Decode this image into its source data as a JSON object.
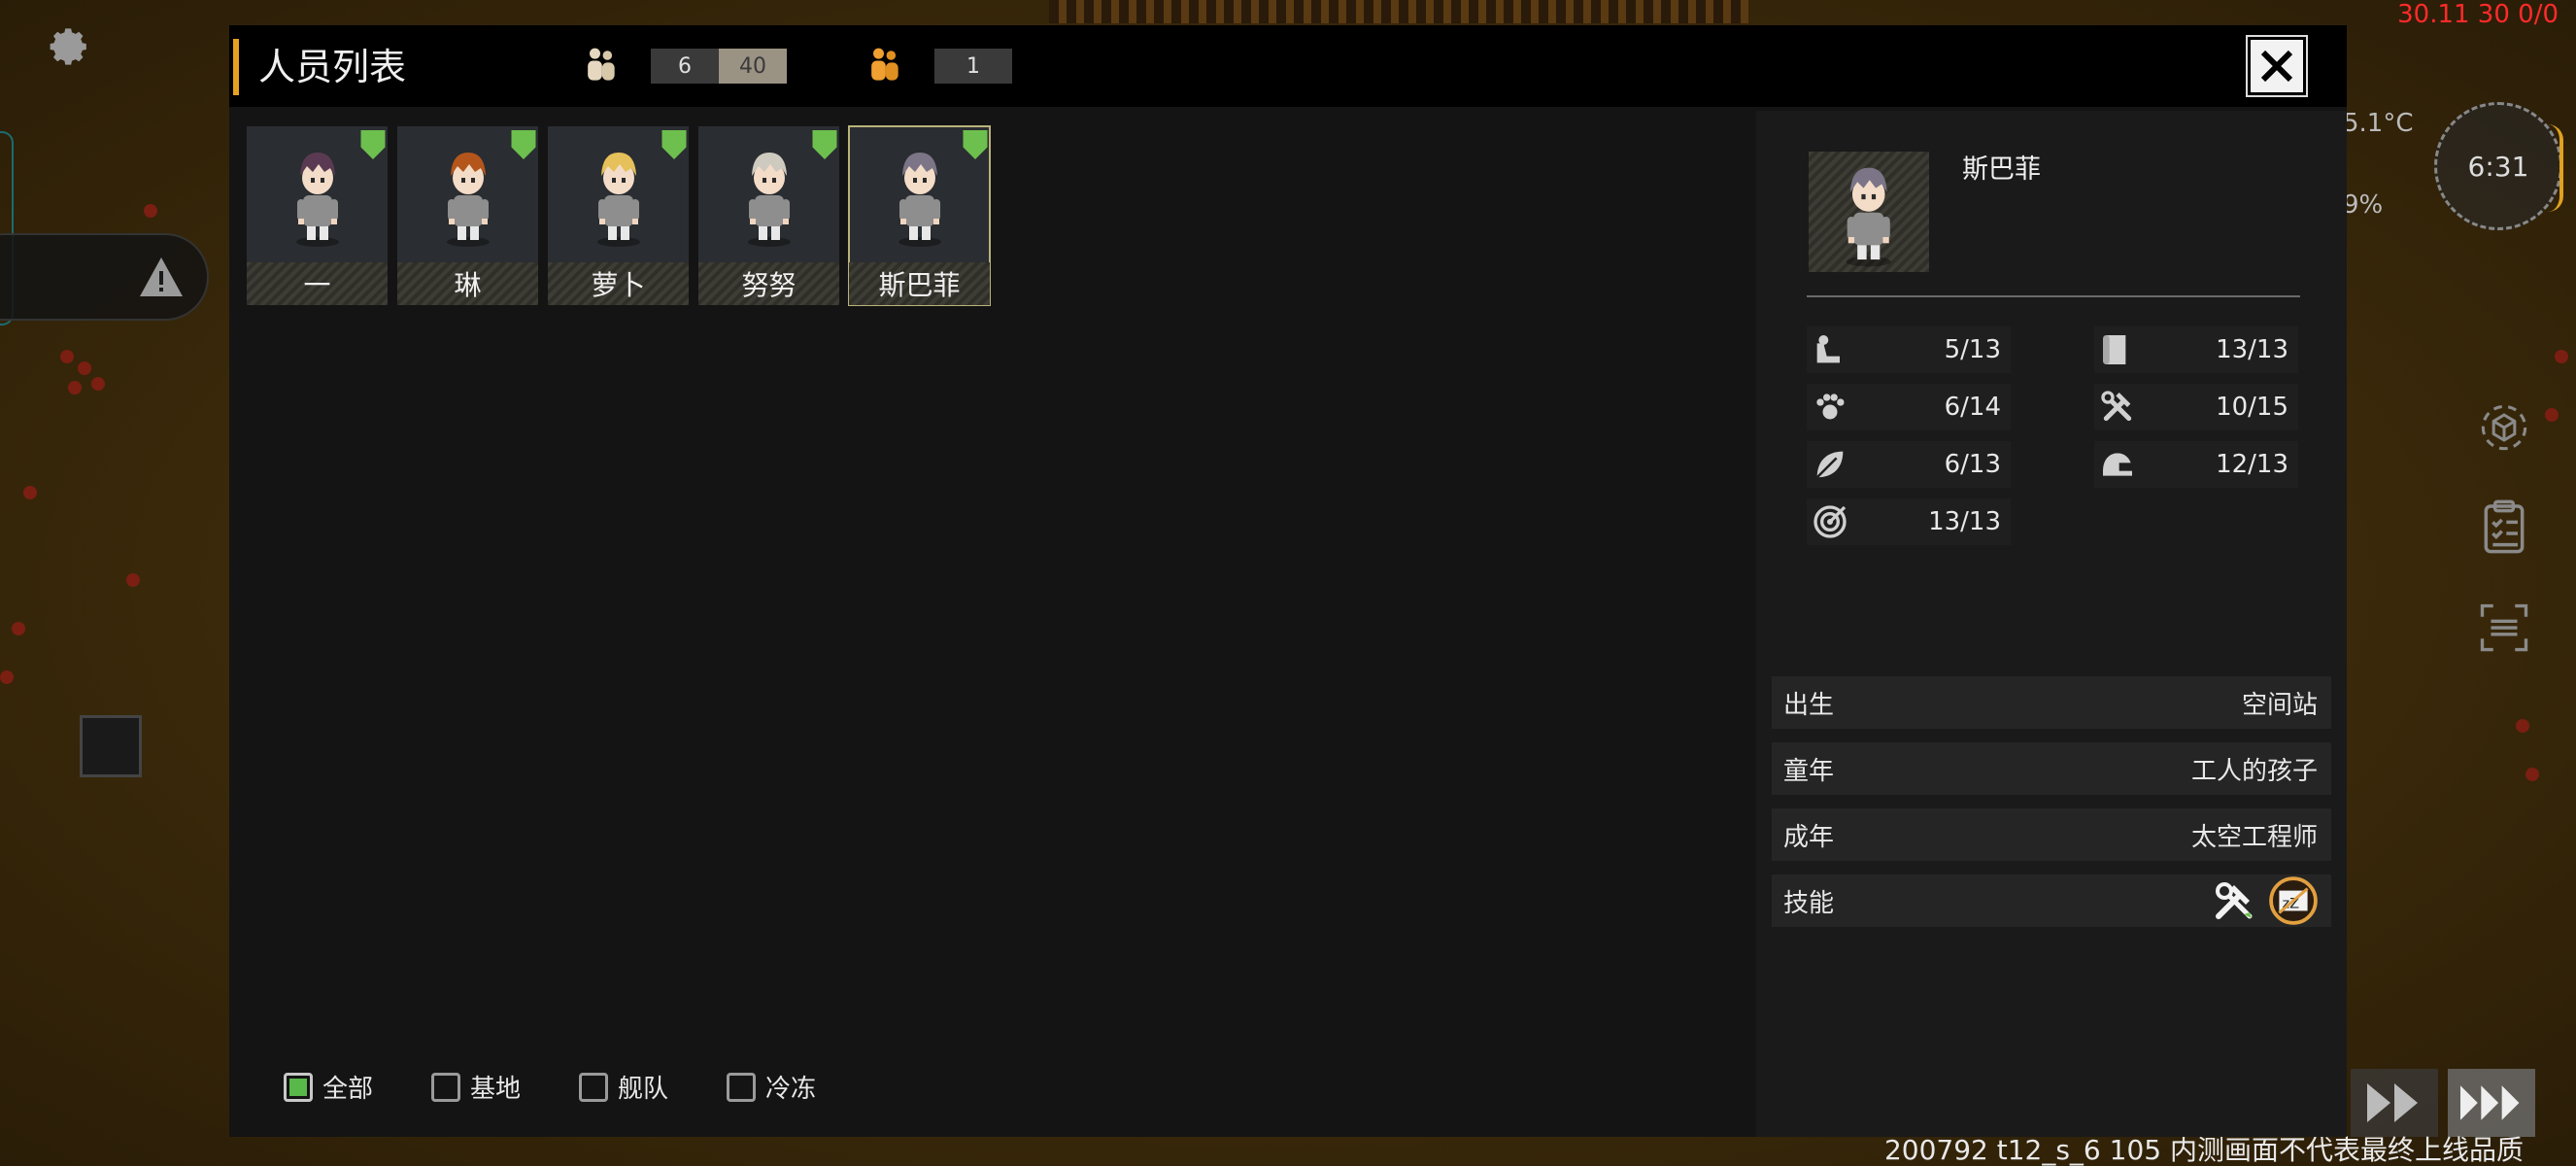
{
  "hud": {
    "top_right_readout": "30.11 30 0/0",
    "temperature": "5.1°C",
    "humidity": "9%",
    "clock_time": "6:31",
    "build_caption": "200792 t12_s_6 105  内测画面不代表最终上线品质"
  },
  "icons": {
    "settings": "gear-icon",
    "alert": "warning-icon",
    "close": "close-icon",
    "fast_forward": "fast-forward-icon",
    "faster_forward": "triple-forward-icon"
  },
  "panel": {
    "title": "人员列表",
    "colonists_count": "6",
    "colonists_capacity": "40",
    "other_count": "1"
  },
  "crew": [
    {
      "name": "一",
      "hair_color": "#5a3a52",
      "selected": false
    },
    {
      "name": "琳",
      "hair_color": "#b4561c",
      "selected": false
    },
    {
      "name": "萝卜",
      "hair_color": "#e6c05a",
      "selected": false
    },
    {
      "name": "努努",
      "hair_color": "#cfcac0",
      "selected": false
    },
    {
      "name": "斯巴菲",
      "hair_color": "#7b7587",
      "selected": true
    }
  ],
  "filters": [
    {
      "label": "全部",
      "checked": true
    },
    {
      "label": "基地",
      "checked": false
    },
    {
      "label": "舰队",
      "checked": false
    },
    {
      "label": "冷冻",
      "checked": false
    }
  ],
  "detail": {
    "name": "斯巴菲",
    "stats": [
      {
        "icon": "strength-icon",
        "value": "5/13"
      },
      {
        "icon": "scroll-icon",
        "value": "13/13"
      },
      {
        "icon": "paw-icon",
        "value": "6/14"
      },
      {
        "icon": "tools-icon",
        "value": "10/15"
      },
      {
        "icon": "leaf-icon",
        "value": "6/13"
      },
      {
        "icon": "helmet-icon",
        "value": "12/13"
      },
      {
        "icon": "target-icon",
        "value": "13/13"
      }
    ],
    "rows": [
      {
        "label": "出生",
        "value": "空间站"
      },
      {
        "label": "童年",
        "value": "工人的孩子"
      },
      {
        "label": "成年",
        "value": "太空工程师"
      }
    ],
    "skills_label": "技能"
  },
  "colors": {
    "accent": "#e6a21e",
    "status_green": "#6dbf4e",
    "warning_red": "#ff2a2a"
  }
}
